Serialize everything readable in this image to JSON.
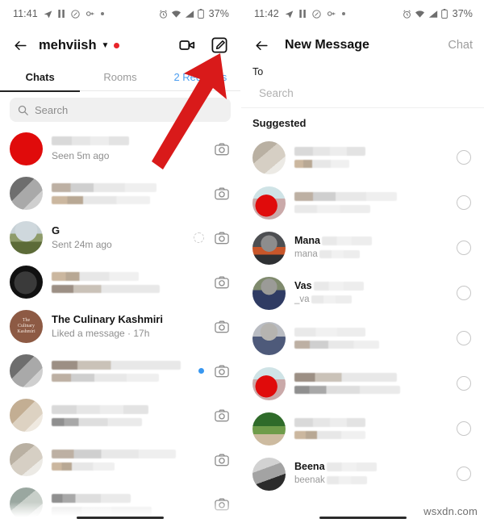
{
  "left": {
    "status": {
      "time": "11:41",
      "battery": "37%",
      "icons": [
        "navigation-icon",
        "pause-icon",
        "dnd-icon",
        "link-icon",
        "dot-icon"
      ],
      "right_icons": [
        "alarm-icon",
        "wifi-icon",
        "signal-icon",
        "battery-icon"
      ]
    },
    "appbar": {
      "back": "back-arrow",
      "username": "mehviish",
      "chevron": "⌄",
      "video_icon": "video-camera-icon",
      "compose_icon": "compose-icon"
    },
    "tabs": [
      {
        "label": "Chats",
        "active": true
      },
      {
        "label": "Rooms",
        "active": false
      },
      {
        "label": "2 Requests",
        "active": false
      }
    ],
    "search": {
      "placeholder": "Search",
      "icon": "search-icon"
    },
    "chats": [
      {
        "name": "",
        "sub": "Seen 5m ago",
        "blurred_name": true,
        "avatar": "av-red",
        "unread": false,
        "ring": false
      },
      {
        "name": "",
        "sub": "",
        "blurred_name": true,
        "blurred_sub": true,
        "avatar": "av-blur1",
        "unread": false,
        "ring": false
      },
      {
        "name": "G",
        "sub": "Sent 24m ago",
        "blurred_name": false,
        "avatar": "av-landscape",
        "unread": false,
        "ring": true
      },
      {
        "name": "",
        "sub": "",
        "blurred_name": true,
        "blurred_sub": true,
        "avatar": "av-dark",
        "unread": false,
        "ring": false
      },
      {
        "name": "The Culinary Kashmiri",
        "sub": "Liked a message · 17h",
        "blurred_name": false,
        "avatar": "av-culinary",
        "unread": false,
        "ring": false
      },
      {
        "name": "",
        "sub": "",
        "blurred_name": true,
        "blurred_sub": true,
        "avatar": "av-blur1",
        "unread": true,
        "ring": false
      },
      {
        "name": "",
        "sub": "",
        "blurred_name": true,
        "blurred_sub": true,
        "avatar": "av-blur2",
        "unread": false,
        "ring": false
      },
      {
        "name": "",
        "sub": "",
        "blurred_name": true,
        "blurred_sub": true,
        "avatar": "av-blur3",
        "unread": false,
        "ring": false
      },
      {
        "name": "",
        "sub": "",
        "blurred_name": true,
        "blurred_sub": true,
        "avatar": "av-blur4",
        "unread": false,
        "ring": false
      }
    ],
    "camera_icon": "camera-icon"
  },
  "right": {
    "status": {
      "time": "11:42",
      "battery": "37%"
    },
    "appbar": {
      "back": "back-arrow",
      "title": "New Message",
      "action": "Chat"
    },
    "to_label": "To",
    "search_placeholder": "Search",
    "section_title": "Suggested",
    "suggested": [
      {
        "name": "",
        "username": "",
        "blurred": true,
        "avatar": "av-blur3"
      },
      {
        "name": "",
        "username": "",
        "blurred": true,
        "avatar": "av-pinkred"
      },
      {
        "name": "Mana",
        "username": "mana",
        "blurred": false,
        "partial": true,
        "avatar": "av-mana"
      },
      {
        "name": "Vas",
        "username": "_va",
        "blurred": false,
        "partial": true,
        "avatar": "av-vas"
      },
      {
        "name": "",
        "username": "",
        "blurred": true,
        "avatar": "av-person"
      },
      {
        "name": "",
        "username": "",
        "blurred": true,
        "avatar": "av-pinkred"
      },
      {
        "name": "",
        "username": "",
        "blurred": true,
        "avatar": "av-green"
      },
      {
        "name": "Beena",
        "username": "beenak",
        "blurred": false,
        "partial": true,
        "avatar": "av-gray"
      }
    ],
    "radio_icon": "radio-circle-icon"
  },
  "overlay": {
    "arrow_color": "#d91a1a",
    "arrow_name": "red-annotation-arrow",
    "watermark": "wsxdn.com"
  },
  "colors": {
    "accent_red": "#e8252a",
    "unread_blue": "#3897f0",
    "requests_blue": "#4a9df0"
  }
}
